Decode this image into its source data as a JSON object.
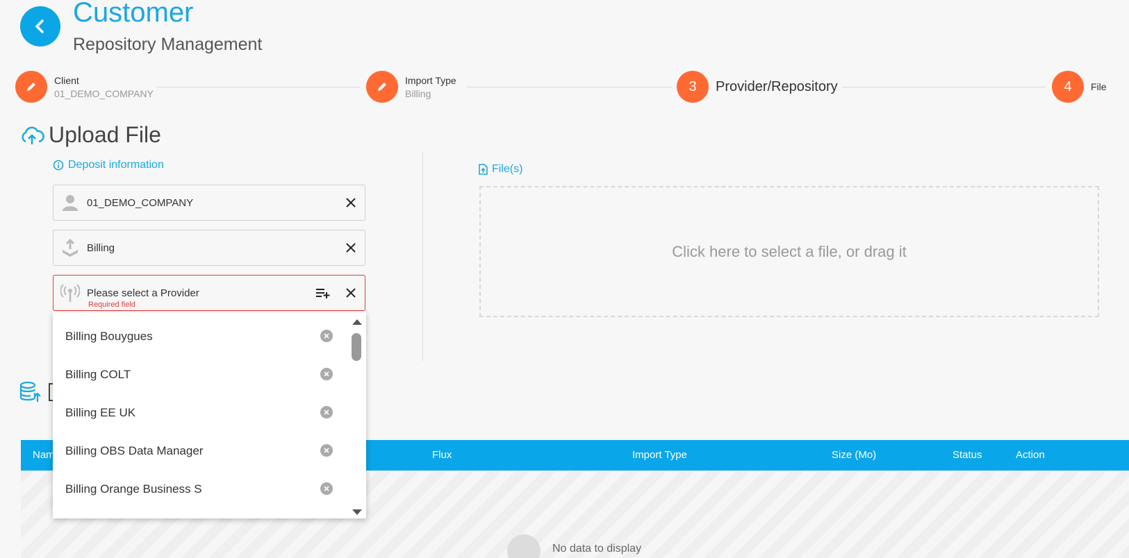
{
  "header": {
    "title": "Customer",
    "subtitle": "Repository Management"
  },
  "stepper": {
    "steps": [
      {
        "label": "Client",
        "value": "01_DEMO_COMPANY"
      },
      {
        "label": "Import Type",
        "value": "Billing"
      },
      {
        "number": "3",
        "label": "Provider/Repository"
      },
      {
        "number": "4",
        "label": "File"
      }
    ]
  },
  "upload": {
    "title": "Upload File",
    "deposit_link": "Deposit information",
    "files_link": "File(s)",
    "client_value": "01_DEMO_COMPANY",
    "import_type_value": "Billing",
    "provider_placeholder": "Please select a Provider",
    "required_text": "Required field",
    "dropzone_text": "Click here to select a file, or drag it"
  },
  "dropdown": {
    "items": [
      "Billing Bouygues",
      "Billing COLT",
      "Billing EE UK",
      "Billing OBS Data Manager",
      "Billing Orange Business S"
    ]
  },
  "table": {
    "columns": [
      "Nam",
      "Flux",
      "Import Type",
      "Size (Mo)",
      "Status",
      "Action"
    ],
    "empty_text": "No data to display"
  },
  "colors": {
    "primary": "#0aa6e6",
    "accent": "#ff6a33",
    "error": "#e23b3b"
  }
}
